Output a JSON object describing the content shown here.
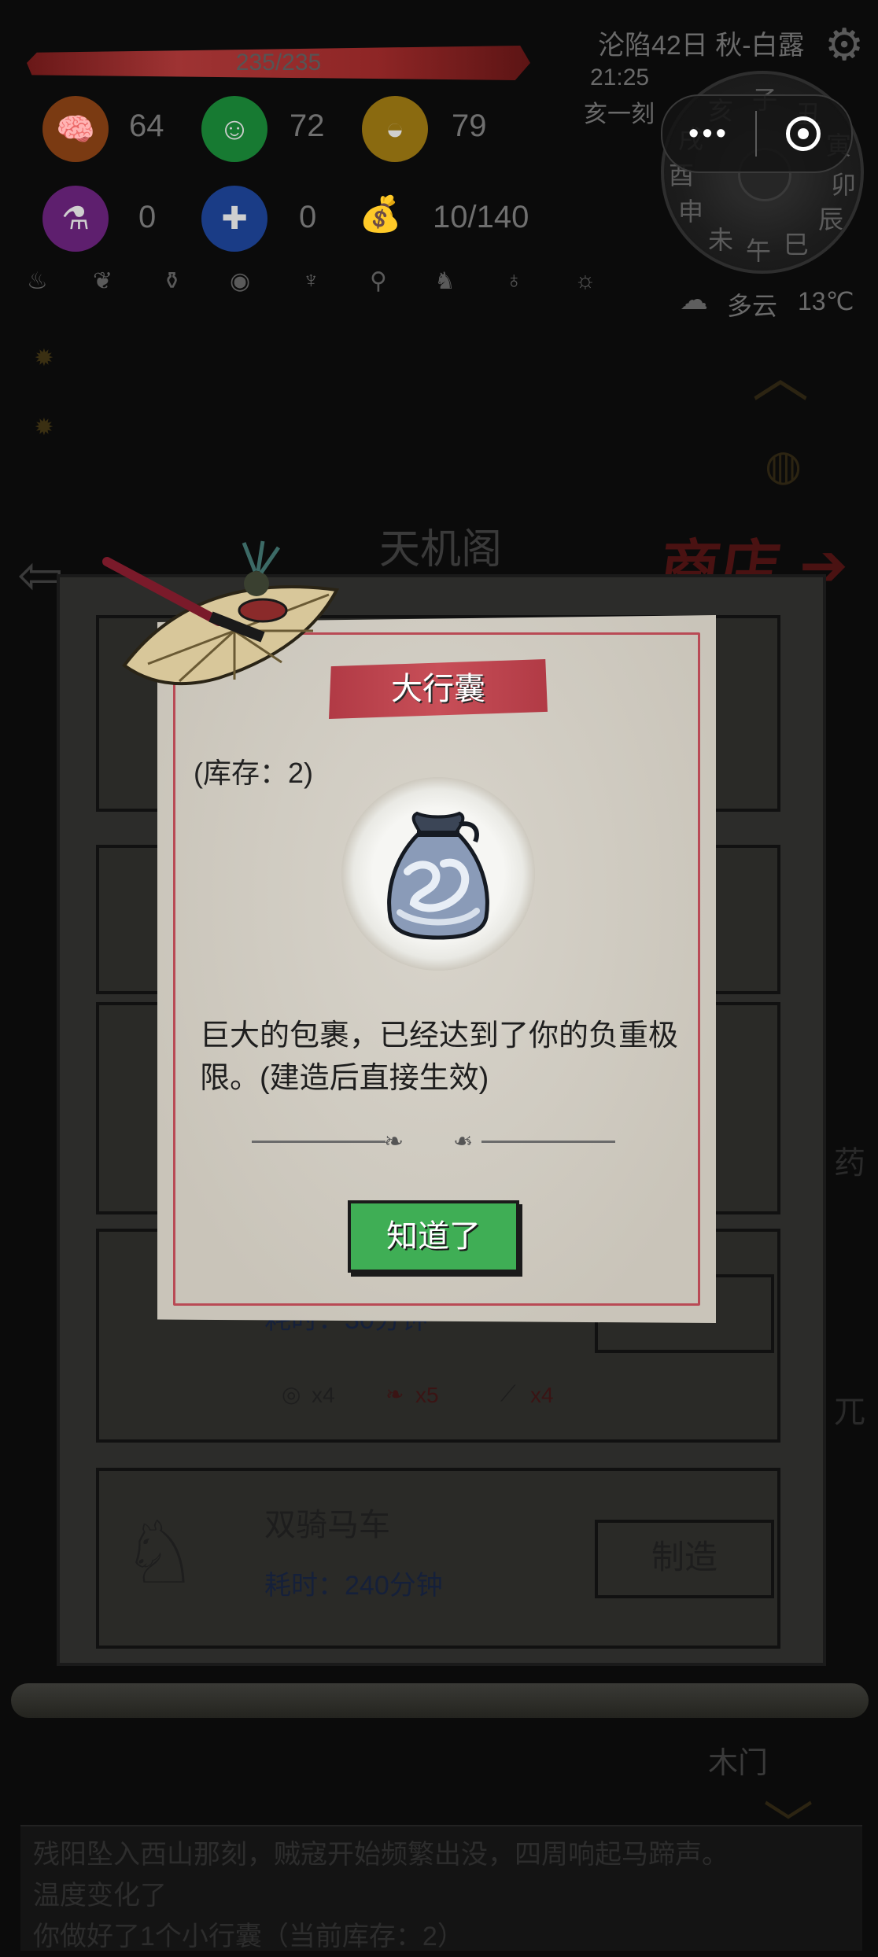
{
  "hud": {
    "hp": "235/235",
    "stats_row1": [
      {
        "icon": "brain-icon",
        "value": "64",
        "color": "#9a4a18"
      },
      {
        "icon": "smile-icon",
        "value": "72",
        "color": "#1d8f3a"
      },
      {
        "icon": "stomach-icon",
        "value": "79",
        "color": "#a07a12"
      }
    ],
    "stats_row2": [
      {
        "icon": "potion-icon",
        "value": "0",
        "color": "#7a2a8a"
      },
      {
        "icon": "bandage-icon",
        "value": "0",
        "color": "#1f4aa0"
      },
      {
        "icon": "bag-icon",
        "value": "10/140"
      }
    ],
    "date": "沦陷42日 秋-白露",
    "time": "21:25",
    "shichen": "亥一刻",
    "weather": "多云",
    "temperature": "13℃",
    "compass_branches": [
      "子",
      "丑",
      "寅",
      "卯",
      "辰",
      "巳",
      "午",
      "未",
      "申",
      "酉",
      "戌",
      "亥"
    ]
  },
  "background_shop": {
    "title": "天机阁",
    "shop_link": "商店",
    "rows": [
      {
        "name": "",
        "time": "耗时：30分钟",
        "materials": [
          {
            "qty": "x4",
            "red": false
          },
          {
            "qty": "x5",
            "red": true
          },
          {
            "qty": "x4",
            "red": true
          }
        ]
      },
      {
        "name": "双骑马车",
        "time": "耗时：240分钟",
        "button": "制造"
      }
    ],
    "side_labels": [
      "药",
      "兀"
    ],
    "wood_gate": "木门"
  },
  "log": {
    "lines": [
      "残阳坠入西山那刻，贼寇开始频繁出没，四周响起马蹄声。",
      "温度变化了",
      "你做好了1个小行囊（当前库存：2）"
    ]
  },
  "modal": {
    "title": "大行囊",
    "stock": "(库存：2)",
    "description": "巨大的包裹，已经达到了你的负重极限。(建造后直接生效)",
    "ok_label": "知道了"
  }
}
